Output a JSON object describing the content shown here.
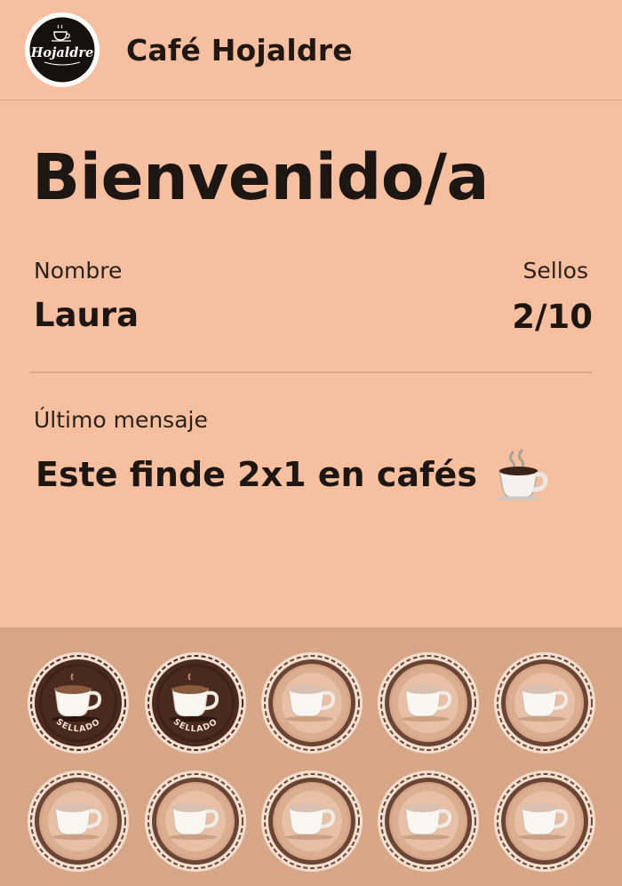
{
  "header": {
    "logo_text": "Hojaldre",
    "store_name": "Café Hojaldre"
  },
  "welcome": "Bienvenido/a",
  "fields": {
    "name_label": "Nombre",
    "name_value": "Laura",
    "stamps_label": "Sellos",
    "stamps_value": "2/10"
  },
  "message": {
    "label": "Último mensaje",
    "text": "Este finde 2x1 en cafés",
    "icon": "hot-coffee-icon"
  },
  "stamps": {
    "total": 10,
    "filled": 2,
    "filled_label": "SELLADO",
    "colors": {
      "filled_ring": "#4a2a1e",
      "empty_ring": "#6b4534",
      "empty_fill": "#d6a587"
    }
  },
  "colors": {
    "card": "#f6c0a0",
    "stamp_area": "#d8a787",
    "text": "#1e1612"
  }
}
